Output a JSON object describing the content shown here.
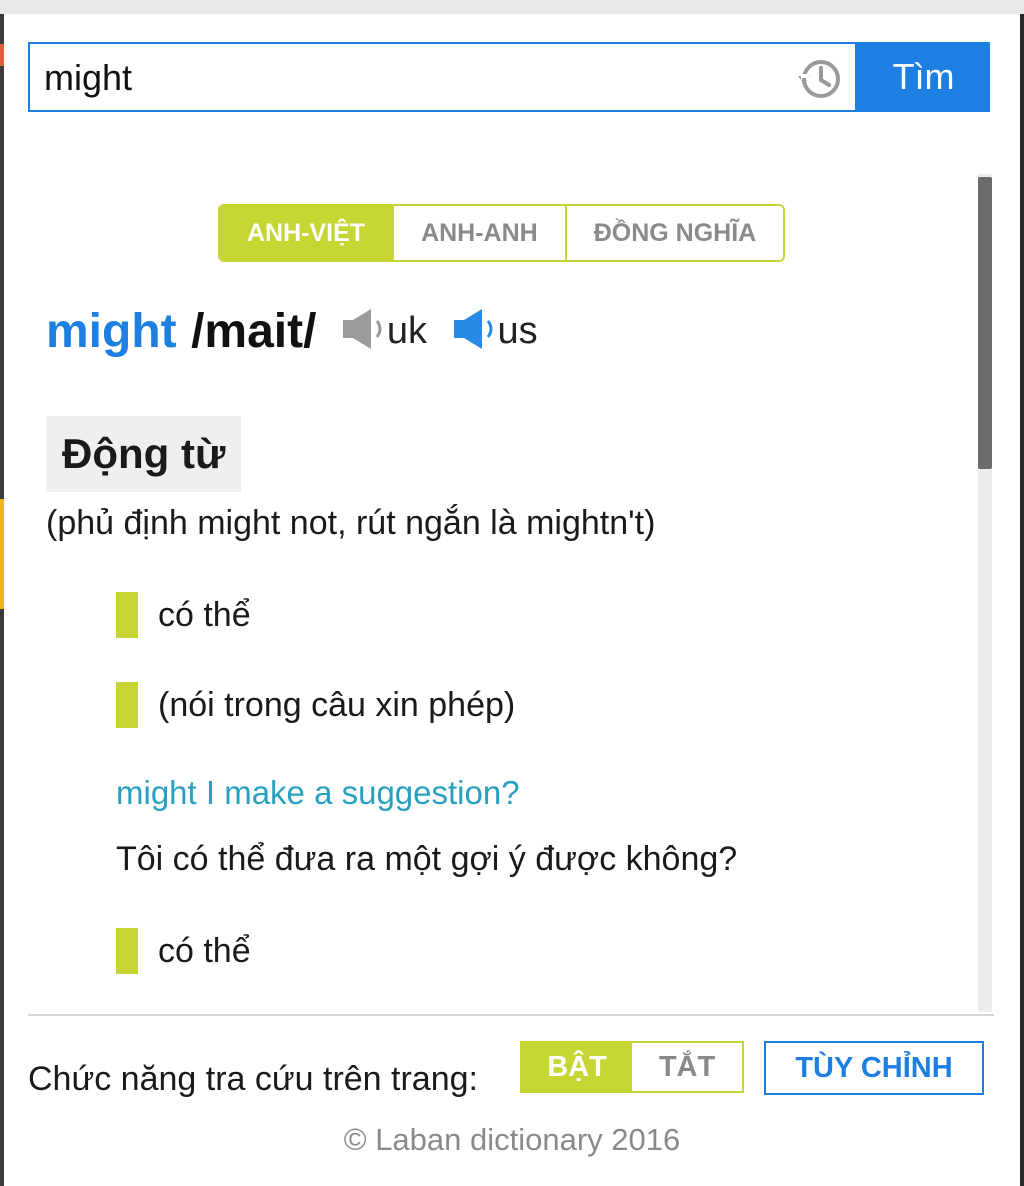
{
  "search": {
    "value": "might",
    "button_label": "Tìm",
    "history_icon": "history-icon"
  },
  "tabs": [
    {
      "label": "ANH-VIỆT",
      "active": true
    },
    {
      "label": "ANH-ANH",
      "active": false
    },
    {
      "label": "ĐỒNG NGHĨA",
      "active": false
    }
  ],
  "entry": {
    "headword": "might",
    "pronunciation": "/mait/",
    "audio": [
      {
        "label": "uk",
        "icon": "speaker-icon",
        "color": "#9a9a9a"
      },
      {
        "label": "us",
        "icon": "speaker-icon",
        "color": "#2a8be6"
      }
    ],
    "part_of_speech": "Động từ",
    "note": "(phủ định might not, rút ngắn là mightn't)",
    "senses": [
      {
        "text": "có thể"
      },
      {
        "text": "(nói trong câu xin phép)"
      },
      {
        "text": "có thể"
      }
    ],
    "example": {
      "text": "might I make a suggestion?",
      "translation": "Tôi có thể đưa ra một gợi ý được không?"
    }
  },
  "footer": {
    "lookup_label": "Chức năng tra cứu trên trang:",
    "toggle_on": "BẬT",
    "toggle_off": "TẮT",
    "toggle_state": "on",
    "customize_label": "TÙY CHỈNH",
    "copyright": "© Laban dictionary 2016"
  },
  "colors": {
    "accent_blue": "#1e7fe3",
    "accent_green": "#c5d632",
    "example_teal": "#2aa0c0"
  }
}
